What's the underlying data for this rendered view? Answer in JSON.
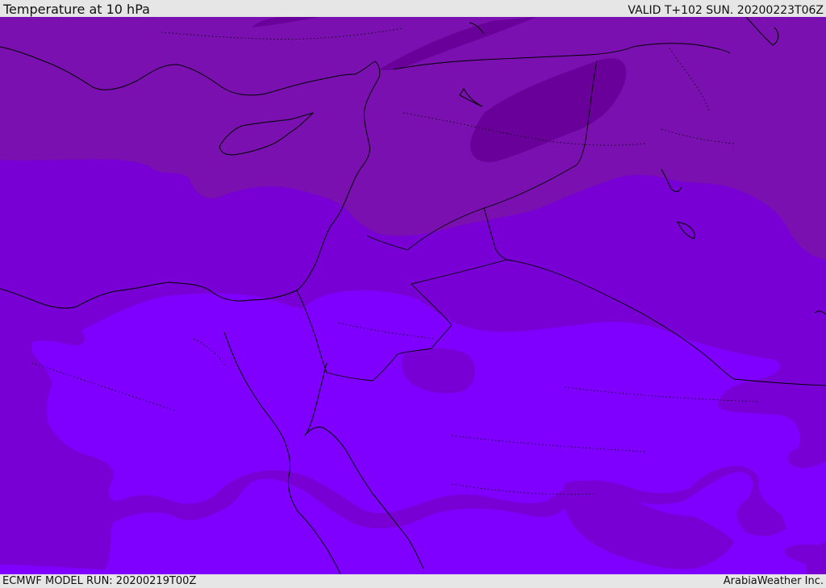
{
  "header": {
    "title": "Temperature at 10 hPa",
    "valid": "VALID T+102 SUN. 20200223T06Z"
  },
  "footer": {
    "model_run": "ECMWF MODEL RUN: 20200219T00Z",
    "credit": "ArabiaWeather Inc."
  },
  "colors": {
    "band_coldest": "#6a009a",
    "band_cold": "#7a10b0",
    "band_mid": "#7800d4",
    "band_warm": "#7f00ff",
    "coastline": "#000000",
    "header_bg": "#e6e6e6"
  }
}
